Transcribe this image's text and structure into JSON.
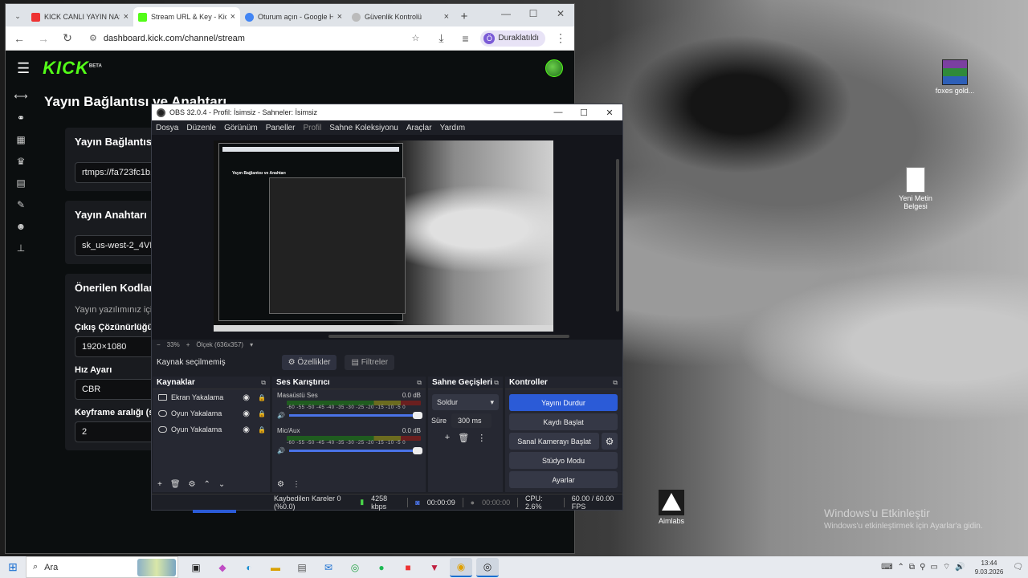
{
  "chrome": {
    "tabs": [
      {
        "label": "KICK CANLI YAYIN NASIL",
        "color": "#e33",
        "active": false
      },
      {
        "label": "Stream URL & Key - Kick",
        "color": "#1b1b1b",
        "active": true
      },
      {
        "label": "Oturum açın - Google H",
        "color": "#4285f4",
        "active": false
      },
      {
        "label": "Güvenlik Kontrolü",
        "color": "#aaa",
        "active": false
      }
    ],
    "new_tab": "+",
    "url": "dashboard.kick.com/channel/stream",
    "profile_letter": "Ö",
    "profile_status": "Duraklatıldı"
  },
  "kick": {
    "logo": "KICK",
    "logo_beta": "BETA",
    "page_title": "Yayın Bağlantısı ve Anahtarı",
    "stream_link_title": "Yayın Bağlantısı",
    "stream_link_value": "rtmps://fa723fc1b17",
    "stream_key_title": "Yayın Anahtarı",
    "stream_key_value": "sk_us-west-2_4VNA",
    "encoding_title": "Önerilen Kodlam",
    "encoding_desc": "Yayın yazılımınız için ö",
    "resolution_label": "Çıkış Çözünürlüğü",
    "resolution_value": "1920×1080",
    "rate_label": "Hız Ayarı",
    "rate_value": "CBR",
    "keyframe_label": "Keyframe aralığı (san",
    "keyframe_value": "2"
  },
  "obs": {
    "title": "OBS 32.0.4 - Profil: İsimsiz - Sahneler: İsimsiz",
    "menu": [
      "Dosya",
      "Düzenle",
      "Görünüm",
      "Paneller",
      "Profil",
      "Sahne Koleksiyonu",
      "Araçlar",
      "Yardım"
    ],
    "zoom_pct": "33%",
    "scale_label": "Ölçek (636x357)",
    "no_source": "Kaynak seçilmemiş",
    "properties": "Özellikler",
    "filters": "Filtreler",
    "sources_title": "Kaynaklar",
    "sources": [
      {
        "name": "Ekran Yakalama"
      },
      {
        "name": "Oyun Yakalama"
      },
      {
        "name": "Oyun Yakalama"
      }
    ],
    "scenes_tab": "Sahneler",
    "sources_tab": "Kaynaklar",
    "mixer_title": "Ses Karıştırıcı",
    "mixer": [
      {
        "name": "Masaüstü Ses",
        "db": "0.0 dB"
      },
      {
        "name": "Mic/Aux",
        "db": "0.0 dB"
      }
    ],
    "meter_scale": "-60 -55 -50 -45 -40 -35 -30 -25 -20 -15 -10 -5 0",
    "transitions_title": "Sahne Geçişleri",
    "transition": "Soldur",
    "duration_label": "Süre",
    "duration_value": "300 ms",
    "controls_title": "Kontroller",
    "controls": [
      "Yayını Durdur",
      "Kaydı Başlat",
      "Sanal Kamerayı Başlat",
      "Stüdyo Modu",
      "Ayarlar"
    ],
    "status": {
      "dropped": "Kaybedilen Kareler 0 (%0.0)",
      "bitrate": "4258 kbps",
      "live_time": "00:00:09",
      "rec_time": "00:00:00",
      "cpu": "CPU: 2.6%",
      "fps": "60.00 / 60.00 FPS"
    }
  },
  "desktop": {
    "icons": [
      {
        "label": "foxes gold..."
      },
      {
        "label": "Yeni Metin Belgesi"
      },
      {
        "label": "Aimlabs"
      }
    ],
    "watermark_title": "Windows'u Etkinleştir",
    "watermark_sub": "Windows'u etkinleştirmek için Ayarlar'a gidin."
  },
  "taskbar": {
    "search_label": "Ara",
    "time": "13:44",
    "date": "9.03.2026"
  }
}
